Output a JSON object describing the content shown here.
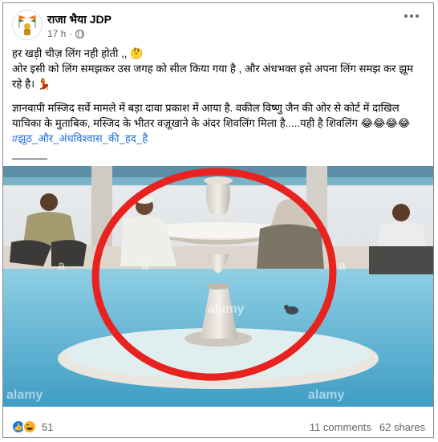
{
  "post": {
    "author": "राजा भैया JDP",
    "time": "17 h",
    "dot": "·",
    "line1": "हर खड़ी चीज़ लिंग नही होती ,, 🤔",
    "line2": "ओर इसी को लिंग समझकर उस जगह को सील किया गया है , और अंधभक्त इसे अपना लिंग समझ कर झूम रहे है। 💃",
    "para2": "ज्ञानवापी मस्जिद सर्वे मामले में बड़ा दावा प्रकाश में आया है. वकील विष्णु जैन की ओर से कोर्ट में दाखिल याचिका के मुताबिक, मस्जिद के भीतर वज़ूखाने के अंदर शिवलिंग मिला है.....यही है शिवलिंग 😂😂😂😂",
    "hashtag": "#झूठ_और_अंधविश्वास_की_हद_है",
    "separator": "______",
    "watermark": "alamy"
  },
  "footer": {
    "reaction_count": "51",
    "comments": "11 comments",
    "shares": "62 shares"
  },
  "colors": {
    "link": "#216fdb",
    "like": "#1877f2",
    "circle": "#e8231f",
    "water": "#5fb8d8"
  },
  "icons": {
    "avatar": "saffron-flag-avatar",
    "privacy": "globe-icon",
    "menu": "more-horizontal-icon",
    "like": "like-icon",
    "haha": "haha-icon"
  }
}
